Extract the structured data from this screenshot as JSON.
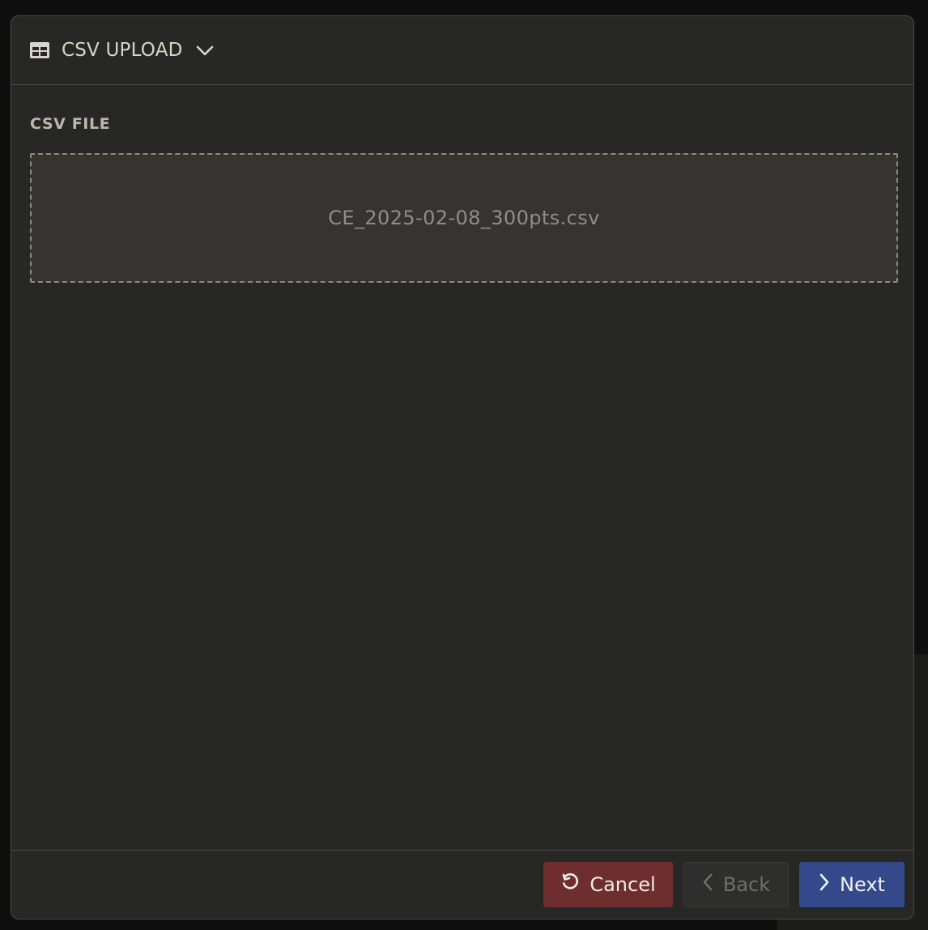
{
  "dialog": {
    "title": "CSV UPLOAD",
    "title_icon": "table-icon",
    "dropdown_icon": "chevron-down-icon"
  },
  "file_section": {
    "label": "CSV FILE",
    "file_name": "CE_2025-02-08_300pts.csv"
  },
  "footer": {
    "cancel_label": "Cancel",
    "cancel_icon": "undo-icon",
    "back_label": "Back",
    "back_icon": "chevron-left-icon",
    "next_label": "Next",
    "next_icon": "chevron-right-icon"
  },
  "colors": {
    "dialog_bg": "#272725",
    "cancel_bg": "#6e2e2e",
    "next_bg": "#34498a",
    "back_bg": "#2e2e2c"
  }
}
